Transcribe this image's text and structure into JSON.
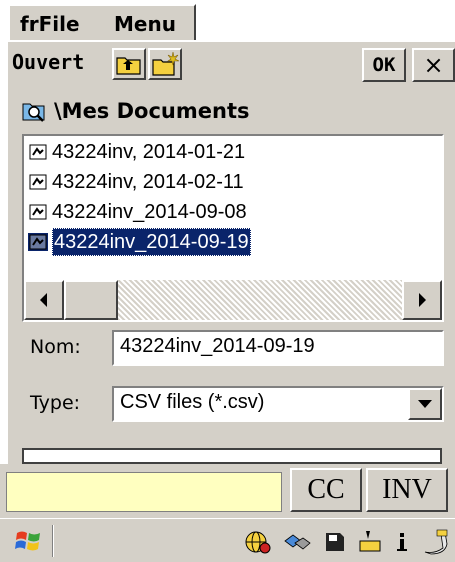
{
  "menu": {
    "file": "frFile",
    "menu": "Menu"
  },
  "toolbar": {
    "title": "Ouvert",
    "ok": "OK",
    "close": "×"
  },
  "path": "\\Mes Documents",
  "files": [
    "43224inv, 2014-01-21",
    "43224inv, 2014-02-11",
    "43224inv_2014-09-08",
    "43224inv_2014-09-19"
  ],
  "name_field": {
    "label": "Nom:",
    "value": "43224inv_2014-09-19"
  },
  "type_field": {
    "label": "Type:",
    "value": "CSV files (*.csv)"
  },
  "bottom": {
    "input_value": "",
    "cc": "CC",
    "inv": "INV"
  },
  "colors": {
    "selection": "#0a246a",
    "input_bg": "#ffffc0",
    "chrome": "#d4d0c8"
  }
}
